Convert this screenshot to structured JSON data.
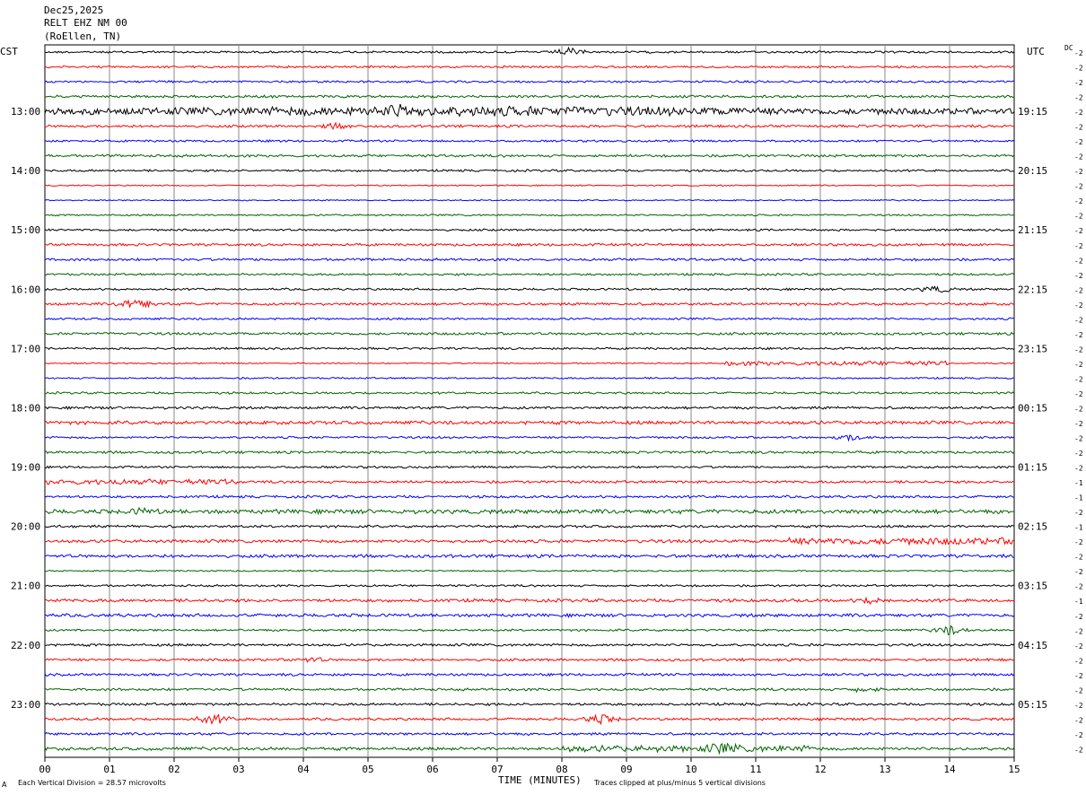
{
  "header": {
    "date": "Dec25,2025",
    "station": "RELT EHZ NM 00",
    "location": "(RoEllen, TN)"
  },
  "left_zone": "CST",
  "right_zone": "UTC",
  "dc_label": "DC",
  "footer": {
    "corner": "A",
    "scale_note": "Each Vertical Division =   28.57 microvolts",
    "clip_note": "Traces clipped at plus/minus 5 vertical divisions"
  },
  "chart_data": {
    "type": "line",
    "title": "",
    "xlabel": "TIME (MINUTES)",
    "ylabel": "",
    "xlim": [
      0,
      15
    ],
    "x_ticks": [
      "00",
      "01",
      "02",
      "03",
      "04",
      "05",
      "06",
      "07",
      "08",
      "09",
      "10",
      "11",
      "12",
      "13",
      "14",
      "15"
    ],
    "left_hour_labels": [
      "13:00",
      "14:00",
      "15:00",
      "16:00",
      "17:00",
      "18:00",
      "19:00",
      "20:00",
      "21:00",
      "22:00",
      "23:00"
    ],
    "right_hour_labels": [
      "19:15",
      "20:15",
      "21:15",
      "22:15",
      "23:15",
      "00:15",
      "01:15",
      "02:15",
      "03:15",
      "04:15",
      "05:15"
    ],
    "trace_colors": [
      "#000000",
      "#ff0000",
      "#0000ff",
      "#006400"
    ],
    "dc_offsets": [
      "-2",
      "-2",
      "-2",
      "-2",
      "-2",
      "-2",
      "-2",
      "-2",
      "-2",
      "-2",
      "-2",
      "-2",
      "-2",
      "-2",
      "-2",
      "-2",
      "-2",
      "-2",
      "-2",
      "-2",
      "-2",
      "-2",
      "-2",
      "-2",
      "-2",
      "-2",
      "-2",
      "-2",
      "-2",
      "-1",
      "-1",
      "-2",
      "-1",
      "-2",
      "-2",
      "-2",
      "-2",
      "-1",
      "-2",
      "-2",
      "-2",
      "-2",
      "-2",
      "-2",
      "-2",
      "-2",
      "-2",
      "-2"
    ],
    "trace_amplitude": [
      1,
      1,
      1,
      1.2,
      3,
      1.2,
      1,
      1.2,
      1,
      0.6,
      0.6,
      0.8,
      1,
      1.2,
      1.2,
      1,
      1,
      1.2,
      1,
      1.2,
      1,
      0.6,
      0.8,
      1,
      1.2,
      1.6,
      1,
      1.2,
      1,
      1.2,
      1.2,
      2,
      1.2,
      1.5,
      1.5,
      0.7,
      1,
      1.5,
      1.5,
      1,
      1.2,
      1.2,
      1.2,
      1.2,
      1.2,
      1.2,
      1.2,
      1.5
    ],
    "bursts": [
      {
        "trace": 0,
        "minute": 8.1,
        "level": 3
      },
      {
        "trace": 4,
        "minute": 5.5,
        "level": 4
      },
      {
        "trace": 5,
        "minute": 4.5,
        "level": 2
      },
      {
        "trace": 17,
        "minute": 1.4,
        "level": 5
      },
      {
        "trace": 16,
        "minute": 13.8,
        "level": 3
      },
      {
        "trace": 26,
        "minute": 12.5,
        "level": 3
      },
      {
        "trace": 31,
        "minute": 1.5,
        "level": 2
      },
      {
        "trace": 37,
        "minute": 12.8,
        "level": 2
      },
      {
        "trace": 39,
        "minute": 14.0,
        "level": 4
      },
      {
        "trace": 41,
        "minute": 4.1,
        "level": 2
      },
      {
        "trace": 43,
        "minute": 12.7,
        "level": 2
      },
      {
        "trace": 45,
        "minute": 2.6,
        "level": 4
      },
      {
        "trace": 45,
        "minute": 8.6,
        "level": 4
      },
      {
        "trace": 47,
        "minute": 10.5,
        "level": 3
      }
    ]
  }
}
